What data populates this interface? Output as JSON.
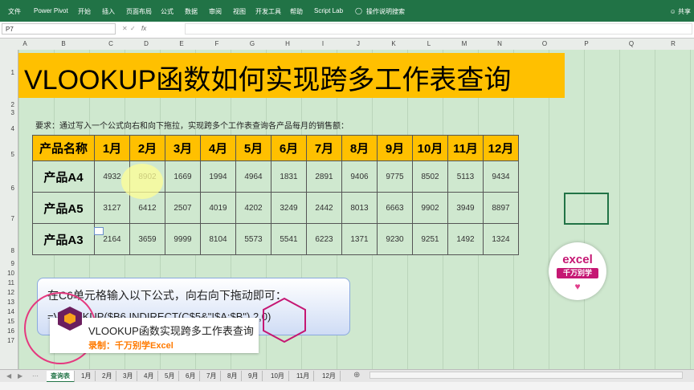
{
  "ribbon": {
    "tabs": [
      "文件",
      "Power Pivot",
      "开始",
      "插入",
      "页面布局",
      "公式",
      "数据",
      "审阅",
      "视图",
      "开发工具",
      "帮助",
      "Script Lab"
    ],
    "search_label": "操作说明搜索",
    "share_label": "共享",
    "bg_color": "#217346"
  },
  "formula_bar": {
    "name_box": "P7",
    "fx": "fx",
    "value": ""
  },
  "columns": [
    "A",
    "B",
    "C",
    "D",
    "E",
    "F",
    "G",
    "H",
    "I",
    "J",
    "K",
    "L",
    "M",
    "N",
    "O",
    "P",
    "Q",
    "R"
  ],
  "rows": [
    "1",
    "2",
    "3",
    "4",
    "5",
    "6",
    "7",
    "8",
    "9",
    "10",
    "11",
    "12",
    "13",
    "14",
    "15",
    "16",
    "17"
  ],
  "title": "VLOOKUP函数如何实现跨多工作表查询",
  "requirement": "要求：通过写入一个公式向右和向下拖拉，实现跨多个工作表查询各产品每月的销售额：",
  "table": {
    "header": [
      "产品名称",
      "1月",
      "2月",
      "3月",
      "4月",
      "5月",
      "6月",
      "7月",
      "8月",
      "9月",
      "10月",
      "11月",
      "12月"
    ],
    "rows": [
      {
        "name": "产品A4",
        "values": [
          "4932",
          "8902",
          "1669",
          "1994",
          "4964",
          "1831",
          "2891",
          "9406",
          "9775",
          "8502",
          "5113",
          "9434"
        ]
      },
      {
        "name": "产品A5",
        "values": [
          "3127",
          "6412",
          "2507",
          "4019",
          "4202",
          "3249",
          "2442",
          "8013",
          "6663",
          "9902",
          "3949",
          "8897"
        ]
      },
      {
        "name": "产品A3",
        "values": [
          "2164",
          "3659",
          "9999",
          "8104",
          "5573",
          "5541",
          "6223",
          "1371",
          "9230",
          "9251",
          "1492",
          "1324"
        ]
      }
    ]
  },
  "callout": {
    "line1": "在C6单元格输入以下公式，向右向下拖动即可：",
    "line2": "=VLOOKUP($B6,INDIRECT(C$5&\"!$A:$B\"),2,0)"
  },
  "lower_third": {
    "title": "VLOOKUP函数实现跨多工作表查询",
    "subtitle": "录制：千万别学Excel"
  },
  "logo": {
    "line1": "excel",
    "line2": "千万别学"
  },
  "sheets": [
    "查询表",
    "1月",
    "2月",
    "3月",
    "4月",
    "5月",
    "6月",
    "7月",
    "8月",
    "9月",
    "10月",
    "11月",
    "12月"
  ],
  "active_sheet": "查询表"
}
